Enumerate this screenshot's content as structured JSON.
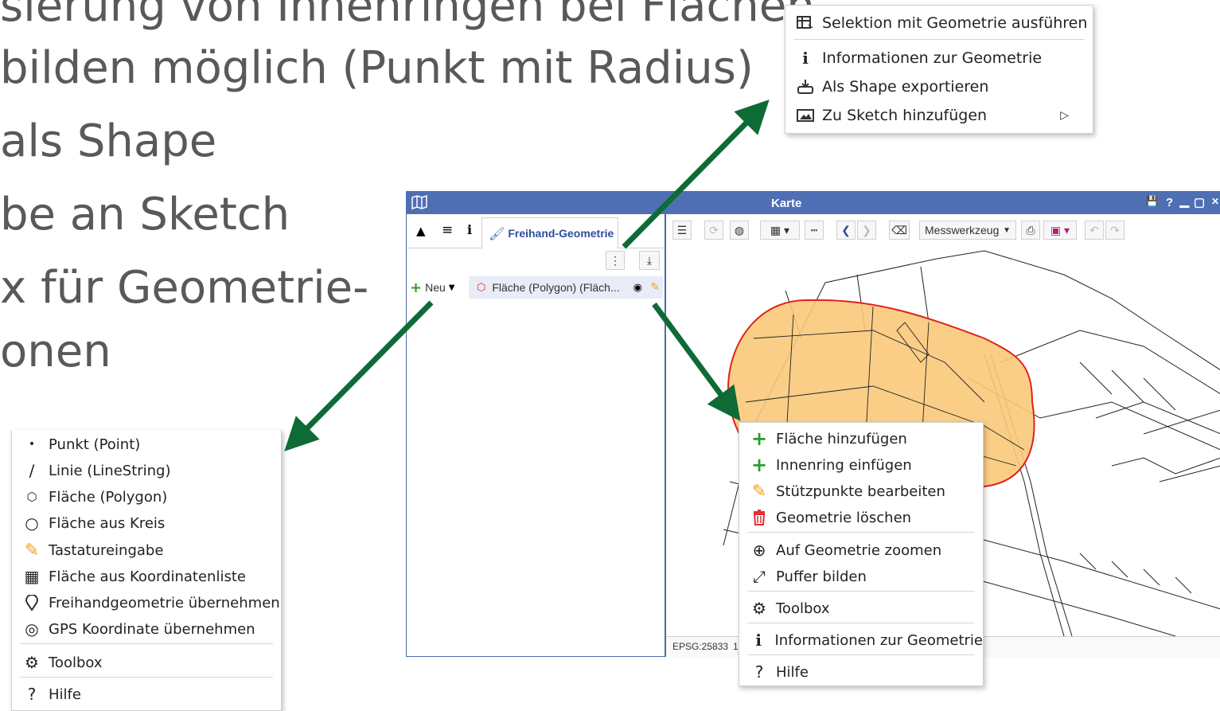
{
  "slide": {
    "bullets": [
      "sierung von Innenringen bei Flächen",
      "bilden möglich (Punkt mit Radius)",
      "als Shape",
      "be an Sketch",
      "x für Geometrie-",
      "onen"
    ]
  },
  "top_menu": {
    "items": [
      {
        "label": "Selektion mit Geometrie ausführen",
        "icon": "table-select-icon"
      },
      {
        "label": "Informationen zur Geometrie",
        "icon": "info-icon"
      },
      {
        "label": "Als Shape exportieren",
        "icon": "export-shape-icon"
      },
      {
        "label": "Zu Sketch hinzufügen",
        "icon": "image-icon",
        "submenu_glyph": "▷"
      }
    ]
  },
  "left_menu": {
    "items": [
      {
        "label": "Punkt (Point)",
        "icon": "point-icon",
        "glyph": "•"
      },
      {
        "label": "Linie (LineString)",
        "icon": "line-icon",
        "glyph": "∕"
      },
      {
        "label": "Fläche (Polygon)",
        "icon": "polygon-icon",
        "glyph": "⬡"
      },
      {
        "label": "Fläche aus Kreis",
        "icon": "circle-icon",
        "glyph": "○"
      },
      {
        "label": "Tastatureingabe",
        "icon": "pencil-icon",
        "glyph": "✎"
      },
      {
        "label": "Fläche aus Koordinatenliste",
        "icon": "table-icon",
        "glyph": "▦"
      },
      {
        "label": "Freihandgeometrie übernehmen",
        "icon": "map-pin-icon",
        "glyph": "⚲"
      },
      {
        "label": "GPS Koordinate übernehmen",
        "icon": "gps-icon",
        "glyph": "◎"
      },
      {
        "label": "Toolbox",
        "icon": "gears-icon",
        "glyph": "⚙"
      },
      {
        "label": "Hilfe",
        "icon": "help-icon",
        "glyph": "?"
      }
    ]
  },
  "right_menu": {
    "items": [
      {
        "label": "Fläche hinzufügen",
        "icon": "plus-icon",
        "glyph": "+"
      },
      {
        "label": "Innenring einfügen",
        "icon": "plus-icon",
        "glyph": "+"
      },
      {
        "label": "Stützpunkte bearbeiten",
        "icon": "pencil-icon",
        "glyph": "✎"
      },
      {
        "label": "Geometrie löschen",
        "icon": "trash-icon",
        "glyph": "🗑"
      },
      {
        "label": "Auf Geometrie zoomen",
        "icon": "zoom-in-icon",
        "glyph": "⊕"
      },
      {
        "label": "Puffer bilden",
        "icon": "expand-icon",
        "glyph": "⤢"
      },
      {
        "label": "Toolbox",
        "icon": "gears-icon",
        "glyph": "⚙"
      },
      {
        "label": "Informationen zur Geometrie",
        "icon": "info-icon",
        "glyph": "i"
      },
      {
        "label": "Hilfe",
        "icon": "help-icon",
        "glyph": "?"
      }
    ]
  },
  "app": {
    "title": "Karte",
    "window_controls": [
      "💾",
      "?",
      "▁",
      "▢",
      "✕"
    ],
    "left_tabs": {
      "icons": [
        "tree-icon",
        "list-icon",
        "info-icon"
      ],
      "active_tab": "Freihand-Geometrie"
    },
    "new_button": "Neu",
    "layer_item": "Fläche (Polygon) (Fläch...",
    "toolbar": {
      "measure_select": "Messwerkzeug"
    },
    "status": {
      "epsg": "EPSG:25833",
      "scale_prefix": "1"
    }
  },
  "colors": {
    "titlebar": "#4f6fb5",
    "polygon_fill": "#fbc97a",
    "polygon_stroke": "#e0231b",
    "arrow": "#0e6b35",
    "plus_green": "#2e9a2e",
    "pencil_orange": "#f0a020",
    "trash_red": "#e03030"
  }
}
